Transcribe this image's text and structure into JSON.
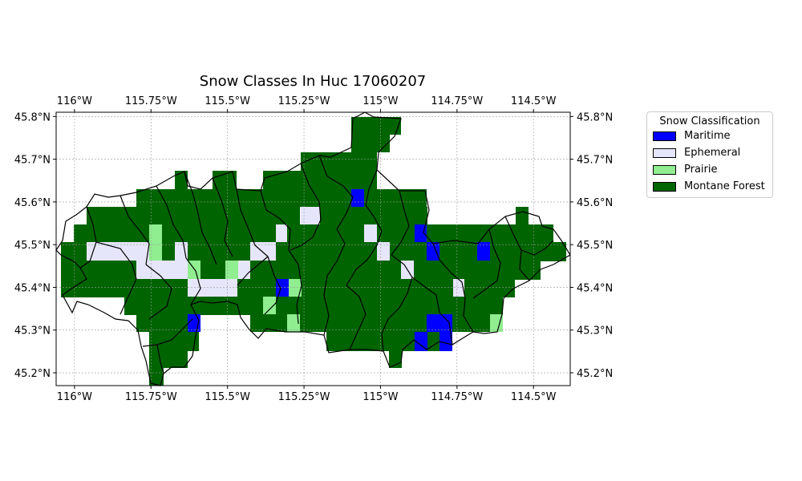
{
  "title": "Snow Classes In Huc 17060207",
  "lon_ticks": [
    "116°W",
    "115.75°W",
    "115.5°W",
    "115.25°W",
    "115°W",
    "114.75°W",
    "114.5°W"
  ],
  "lat_ticks": [
    "45.8°N",
    "45.7°N",
    "45.6°N",
    "45.5°N",
    "45.4°N",
    "45.3°N",
    "45.2°N"
  ],
  "legend": {
    "title": "Snow Classification",
    "items": [
      {
        "label": "Maritime",
        "color": "#0000ff"
      },
      {
        "label": "Ephemeral",
        "color": "#e6e6fa"
      },
      {
        "label": "Prairie",
        "color": "#90ee90"
      },
      {
        "label": "Montane Forest",
        "color": "#006400"
      }
    ]
  },
  "chart_data": {
    "type": "heatmap",
    "title": "Snow Classes In Huc 17060207",
    "xlim": [
      -116.06,
      -114.38
    ],
    "ylim": [
      45.17,
      45.81
    ],
    "grid": true,
    "legend_placement": "outside right",
    "classes": [
      "Maritime",
      "Ephemeral",
      "Prairie",
      "Montane Forest"
    ]
  }
}
